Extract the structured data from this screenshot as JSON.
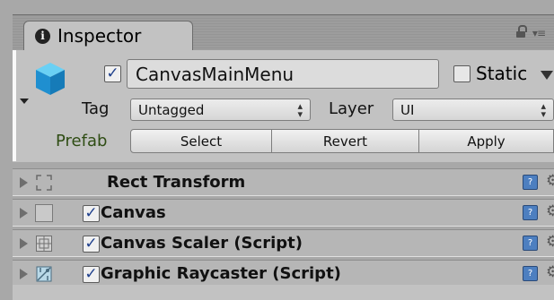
{
  "tab": {
    "title": "Inspector"
  },
  "header": {
    "active_checked": true,
    "object_name": "CanvasMainMenu",
    "static_checked": false,
    "static_label": "Static",
    "tag_label": "Tag",
    "tag_value": "Untagged",
    "layer_label": "Layer",
    "layer_value": "UI",
    "prefab_label": "Prefab",
    "prefab_buttons": {
      "select": "Select",
      "revert": "Revert",
      "apply": "Apply"
    }
  },
  "components": [
    {
      "name": "Rect Transform",
      "icon": "rect-transform-icon",
      "has_checkbox": false
    },
    {
      "name": "Canvas",
      "icon": "canvas-icon",
      "has_checkbox": true,
      "checked": true
    },
    {
      "name": "Canvas Scaler (Script)",
      "icon": "canvas-scaler-icon",
      "has_checkbox": true,
      "checked": true
    },
    {
      "name": "Graphic Raycaster (Script)",
      "icon": "graphic-raycaster-icon",
      "has_checkbox": true,
      "checked": true
    }
  ],
  "colors": {
    "panel": "#c2c2c2",
    "prefab_label": "#2f4d14",
    "checkmark": "#1e3f8c",
    "help": "#4d7fc0"
  }
}
